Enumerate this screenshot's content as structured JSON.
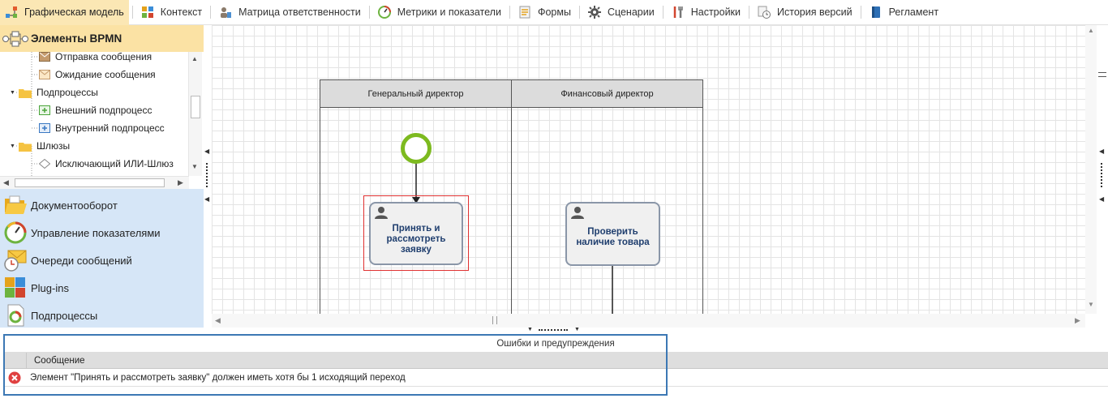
{
  "tabs": [
    {
      "label": "Графическая модель",
      "icon": "process-model-icon",
      "active": true
    },
    {
      "label": "Контекст",
      "icon": "puzzle-icon"
    },
    {
      "label": "Матрица ответственности",
      "icon": "users-matrix-icon"
    },
    {
      "label": "Метрики и показатели",
      "icon": "gauge-icon"
    },
    {
      "label": "Формы",
      "icon": "form-icon"
    },
    {
      "label": "Сценарии",
      "icon": "gear-icon"
    },
    {
      "label": "Настройки",
      "icon": "tools-icon"
    },
    {
      "label": "История версий",
      "icon": "history-icon"
    },
    {
      "label": "Регламент",
      "icon": "book-icon"
    }
  ],
  "palette": {
    "header": "Элементы BPMN",
    "tree": [
      {
        "label": "Отправка сообщения",
        "level": 2,
        "icon": "send-message-icon"
      },
      {
        "label": "Ожидание сообщения",
        "level": 2,
        "icon": "receive-message-icon"
      },
      {
        "label": "Подпроцессы",
        "level": 1,
        "icon": "folder-icon"
      },
      {
        "label": "Внешний подпроцесс",
        "level": 2,
        "icon": "external-subprocess-icon"
      },
      {
        "label": "Внутренний подпроцесс",
        "level": 2,
        "icon": "internal-subprocess-icon"
      },
      {
        "label": "Шлюзы",
        "level": 1,
        "icon": "folder-icon"
      },
      {
        "label": "Исключающий ИЛИ-Шлюз",
        "level": 2,
        "icon": "gateway-icon"
      }
    ]
  },
  "nav": [
    {
      "label": "Документооборот",
      "icon": "folder-open-icon"
    },
    {
      "label": "Управление показателями",
      "icon": "gauge-icon"
    },
    {
      "label": "Очереди сообщений",
      "icon": "message-queue-icon"
    },
    {
      "label": "Plug-ins",
      "icon": "puzzle-icon"
    },
    {
      "label": "Подпроцессы",
      "icon": "subprocess-doc-icon"
    }
  ],
  "diagram": {
    "lanes": [
      {
        "title": "Генеральный директор"
      },
      {
        "title": "Финансовый директор"
      }
    ],
    "tasks": [
      {
        "label": "Принять и рассмотреть заявку",
        "selected": true
      },
      {
        "label": "Проверить наличие товара",
        "selected": false
      }
    ],
    "colors": {
      "start_event": "#7dba1f",
      "task_border": "#8a96a8",
      "task_text": "#1f3e6e",
      "selection": "#e03030"
    }
  },
  "errors": {
    "title": "Ошибки и предупреждения",
    "column": "Сообщение",
    "rows": [
      {
        "type": "error",
        "message": "Элемент \"Принять и рассмотреть заявку\" должен иметь хотя бы 1 исходящий переход"
      }
    ]
  }
}
